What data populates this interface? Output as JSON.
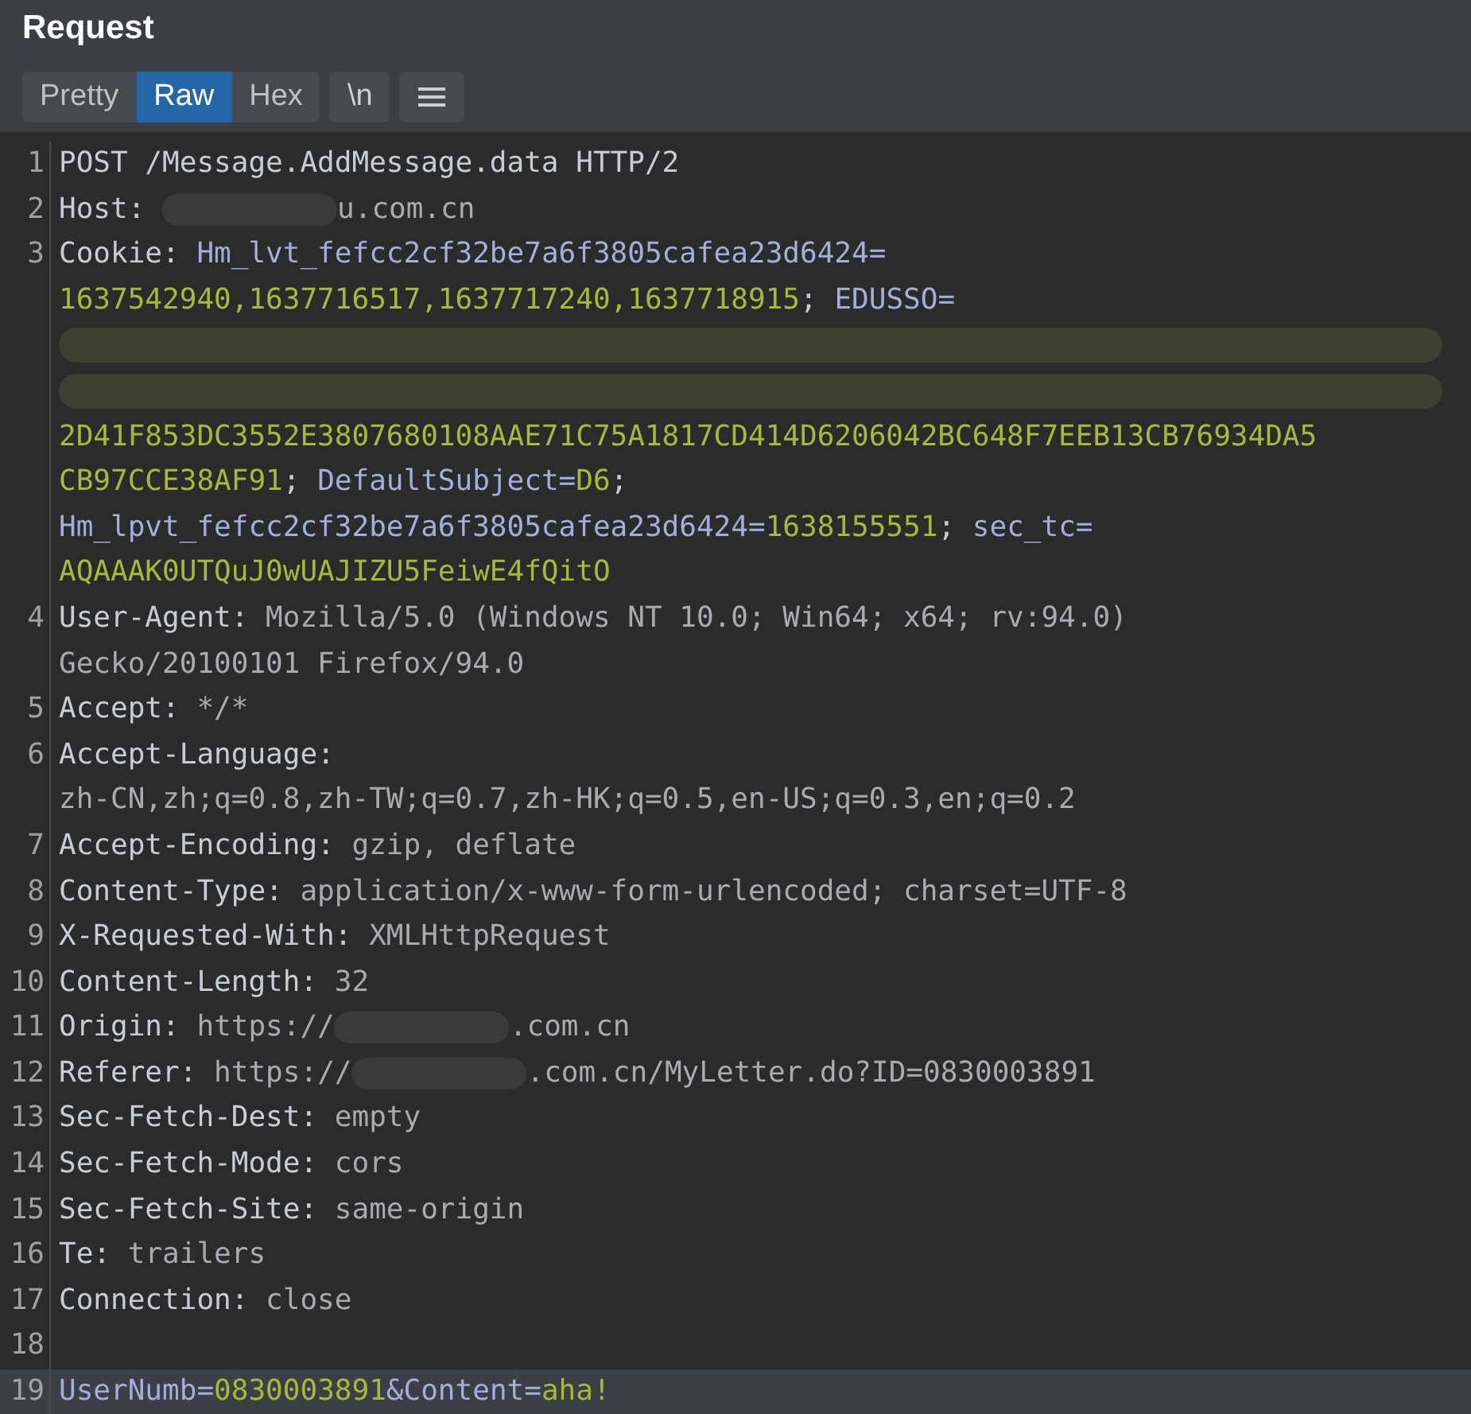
{
  "title": "Request",
  "tabs": [
    {
      "label": "Pretty",
      "selected": false
    },
    {
      "label": "Raw",
      "selected": true
    },
    {
      "label": "Hex",
      "selected": false
    }
  ],
  "toolbar": {
    "newline_toggle": "\\n"
  },
  "lines": [
    {
      "number": "1",
      "highlighted": false,
      "rows": [
        {
          "parts": [
            {
              "kind": "name",
              "text": "POST /Message.AddMessage.data HTTP/2"
            }
          ]
        }
      ]
    },
    {
      "number": "2",
      "highlighted": false,
      "rows": [
        {
          "parts": [
            {
              "kind": "name",
              "text": "Host: "
            },
            {
              "kind": "redacted"
            },
            {
              "kind": "value",
              "text": "u.com.cn"
            }
          ]
        }
      ]
    },
    {
      "number": "3",
      "highlighted": false,
      "rows": [
        {
          "parts": [
            {
              "kind": "name",
              "text": "Cookie: "
            },
            {
              "kind": "param",
              "text": "Hm_lvt_fefcc2cf32be7a6f3805cafea23d6424="
            }
          ]
        },
        {
          "parts": [
            {
              "kind": "param_value",
              "text": "1637542940,1637716517,1637717240,1637718915"
            },
            {
              "kind": "name",
              "text": "; "
            },
            {
              "kind": "param",
              "text": "EDUSSO="
            }
          ]
        },
        {
          "parts": [
            {
              "kind": "redacted_row"
            }
          ]
        },
        {
          "parts": [
            {
              "kind": "redacted_row"
            }
          ]
        },
        {
          "parts": [
            {
              "kind": "param_value",
              "text": "2D41F853DC3552E3807680108AAE71C75A1817CD414D6206042BC648F7EEB13CB76934DA5"
            }
          ]
        },
        {
          "parts": [
            {
              "kind": "param_value",
              "text": "CB97CCE38AF91"
            },
            {
              "kind": "name",
              "text": "; "
            },
            {
              "kind": "param",
              "text": "DefaultSubject="
            },
            {
              "kind": "param_value",
              "text": "D6"
            },
            {
              "kind": "name",
              "text": ";"
            }
          ]
        },
        {
          "parts": [
            {
              "kind": "param",
              "text": "Hm_lpvt_fefcc2cf32be7a6f3805cafea23d6424="
            },
            {
              "kind": "param_value",
              "text": "1638155551"
            },
            {
              "kind": "name",
              "text": "; "
            },
            {
              "kind": "param",
              "text": "sec_tc="
            }
          ]
        },
        {
          "parts": [
            {
              "kind": "param_value",
              "text": "AQAAAK0UTQuJ0wUAJIZU5FeiwE4fQitO"
            }
          ]
        }
      ]
    },
    {
      "number": "4",
      "highlighted": false,
      "rows": [
        {
          "parts": [
            {
              "kind": "name",
              "text": "User-Agent: "
            },
            {
              "kind": "value",
              "text": "Mozilla/5.0 (Windows NT 10.0; Win64; x64; rv:94.0)"
            }
          ]
        },
        {
          "parts": [
            {
              "kind": "value",
              "text": "Gecko/20100101 Firefox/94.0"
            }
          ]
        }
      ]
    },
    {
      "number": "5",
      "highlighted": false,
      "rows": [
        {
          "parts": [
            {
              "kind": "name",
              "text": "Accept: "
            },
            {
              "kind": "value",
              "text": "*/*"
            }
          ]
        }
      ]
    },
    {
      "number": "6",
      "highlighted": false,
      "rows": [
        {
          "parts": [
            {
              "kind": "name",
              "text": "Accept-Language:"
            }
          ]
        },
        {
          "parts": [
            {
              "kind": "value",
              "text": "zh-CN,zh;q=0.8,zh-TW;q=0.7,zh-HK;q=0.5,en-US;q=0.3,en;q=0.2"
            }
          ]
        }
      ]
    },
    {
      "number": "7",
      "highlighted": false,
      "rows": [
        {
          "parts": [
            {
              "kind": "name",
              "text": "Accept-Encoding: "
            },
            {
              "kind": "value",
              "text": "gzip, deflate"
            }
          ]
        }
      ]
    },
    {
      "number": "8",
      "highlighted": false,
      "rows": [
        {
          "parts": [
            {
              "kind": "name",
              "text": "Content-Type: "
            },
            {
              "kind": "value",
              "text": "application/x-www-form-urlencoded; charset=UTF-8"
            }
          ]
        }
      ]
    },
    {
      "number": "9",
      "highlighted": false,
      "rows": [
        {
          "parts": [
            {
              "kind": "name",
              "text": "X-Requested-With: "
            },
            {
              "kind": "value",
              "text": "XMLHttpRequest"
            }
          ]
        }
      ]
    },
    {
      "number": "10",
      "highlighted": false,
      "rows": [
        {
          "parts": [
            {
              "kind": "name",
              "text": "Content-Length: "
            },
            {
              "kind": "value",
              "text": "32"
            }
          ]
        }
      ]
    },
    {
      "number": "11",
      "highlighted": false,
      "rows": [
        {
          "parts": [
            {
              "kind": "name",
              "text": "Origin: "
            },
            {
              "kind": "value",
              "text": "https://"
            },
            {
              "kind": "redacted"
            },
            {
              "kind": "value",
              "text": ".com.cn"
            }
          ]
        }
      ]
    },
    {
      "number": "12",
      "highlighted": false,
      "rows": [
        {
          "parts": [
            {
              "kind": "name",
              "text": "Referer: "
            },
            {
              "kind": "value",
              "text": "https://"
            },
            {
              "kind": "redacted"
            },
            {
              "kind": "value",
              "text": ".com.cn/MyLetter.do?ID=0830003891"
            }
          ]
        }
      ]
    },
    {
      "number": "13",
      "highlighted": false,
      "rows": [
        {
          "parts": [
            {
              "kind": "name",
              "text": "Sec-Fetch-Dest: "
            },
            {
              "kind": "value",
              "text": "empty"
            }
          ]
        }
      ]
    },
    {
      "number": "14",
      "highlighted": false,
      "rows": [
        {
          "parts": [
            {
              "kind": "name",
              "text": "Sec-Fetch-Mode: "
            },
            {
              "kind": "value",
              "text": "cors"
            }
          ]
        }
      ]
    },
    {
      "number": "15",
      "highlighted": false,
      "rows": [
        {
          "parts": [
            {
              "kind": "name",
              "text": "Sec-Fetch-Site: "
            },
            {
              "kind": "value",
              "text": "same-origin"
            }
          ]
        }
      ]
    },
    {
      "number": "16",
      "highlighted": false,
      "rows": [
        {
          "parts": [
            {
              "kind": "name",
              "text": "Te: "
            },
            {
              "kind": "value",
              "text": "trailers"
            }
          ]
        }
      ]
    },
    {
      "number": "17",
      "highlighted": false,
      "rows": [
        {
          "parts": [
            {
              "kind": "name",
              "text": "Connection: "
            },
            {
              "kind": "value",
              "text": "close"
            }
          ]
        }
      ]
    },
    {
      "number": "18",
      "highlighted": false
    },
    {
      "number": "19",
      "highlighted": true,
      "rows": [
        {
          "parts": [
            {
              "kind": "param",
              "text": "UserNumb="
            },
            {
              "kind": "param_value",
              "text": "0830003891"
            },
            {
              "kind": "param",
              "text": "&Content="
            },
            {
              "kind": "param_value",
              "text": "aha!"
            }
          ]
        }
      ]
    }
  ]
}
